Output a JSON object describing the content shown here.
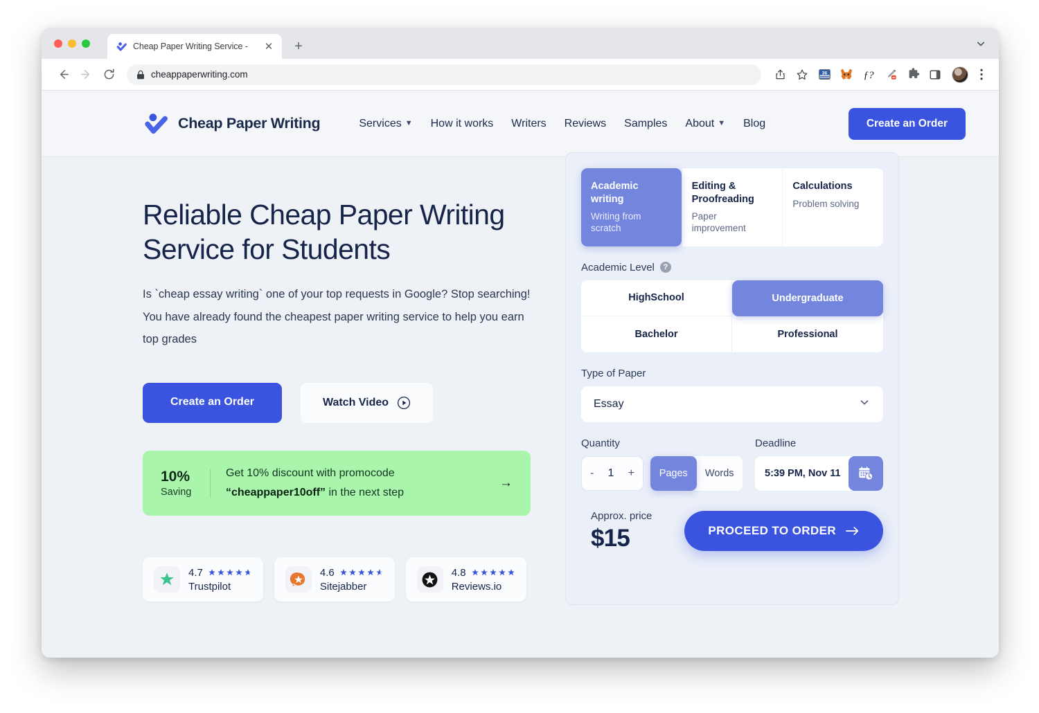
{
  "browser": {
    "tab": {
      "title": "Cheap Paper Writing Service -",
      "favicon_icon": "checkmark-logo-icon",
      "close_icon": "close-icon"
    },
    "new_tab_icon": "plus-icon",
    "tabstrip_chevron_icon": "chevron-down-icon",
    "back_icon": "arrow-left-icon",
    "forward_icon": "arrow-right-icon",
    "reload_icon": "reload-icon",
    "url": "cheappaperwriting.com",
    "lock_icon": "lock-icon",
    "toolbar_icons": [
      {
        "name": "share-icon",
        "label": ""
      },
      {
        "name": "bookmark-star-icon",
        "label": ""
      },
      {
        "name": "counter-badge-icon",
        "label": "36"
      },
      {
        "name": "metamask-fox-icon",
        "label": ""
      },
      {
        "name": "italic-f-question-icon",
        "label": "ƒ?"
      },
      {
        "name": "eyedropper-icon",
        "label": ""
      },
      {
        "name": "extensions-puzzle-icon",
        "label": ""
      },
      {
        "name": "side-panel-icon",
        "label": ""
      }
    ],
    "avatar_icon": "avatar",
    "menu_icon": "kebab-menu-icon"
  },
  "site_header": {
    "logo_icon": "checkmark-logo-icon",
    "brand": "Cheap Paper Writing",
    "nav": [
      {
        "label": "Services",
        "has_caret": true
      },
      {
        "label": "How it works",
        "has_caret": false
      },
      {
        "label": "Writers",
        "has_caret": false
      },
      {
        "label": "Reviews",
        "has_caret": false
      },
      {
        "label": "Samples",
        "has_caret": false
      },
      {
        "label": "About",
        "has_caret": true
      },
      {
        "label": "Blog",
        "has_caret": false
      }
    ],
    "cta": "Create an Order"
  },
  "hero": {
    "title": "Reliable Cheap Paper Writing Service for Students",
    "subtitle": "Is `cheap essay writing` one of your top requests in Google? Stop searching! You have already found the cheapest paper writing service to help you earn top grades",
    "primary_cta": "Create an Order",
    "watch_video": "Watch Video",
    "play_icon": "play-circle-icon"
  },
  "promo": {
    "percent": "10%",
    "saving_label": "Saving",
    "line1": "Get 10% discount with promocode",
    "code": "“cheappaper10off”",
    "line2_tail": " in the next step",
    "arrow_icon": "arrow-right-icon"
  },
  "ratings": [
    {
      "score": "4.7",
      "name": "Trustpilot",
      "icon": "trustpilot-star-icon",
      "stars": 4.7,
      "color": "#3dc28c"
    },
    {
      "score": "4.6",
      "name": "Sitejabber",
      "icon": "sitejabber-bubble-icon",
      "stars": 4.6,
      "color": "#e8762c"
    },
    {
      "score": "4.8",
      "name": "Reviews.io",
      "icon": "reviewsio-star-icon",
      "stars": 4.8,
      "color": "#111111"
    }
  ],
  "order_form": {
    "service_tabs": [
      {
        "title": "Academic writing",
        "subtitle": "Writing from scratch",
        "active": true
      },
      {
        "title": "Editing & Proofreading",
        "subtitle": "Paper improvement",
        "active": false
      },
      {
        "title": "Calculations",
        "subtitle": "Problem solving",
        "active": false
      }
    ],
    "academic_level": {
      "label": "Academic Level",
      "help_icon": "question-mark-icon",
      "help_glyph": "?",
      "options": [
        {
          "label": "HighSchool",
          "active": false
        },
        {
          "label": "Undergraduate",
          "active": true
        },
        {
          "label": "Bachelor",
          "active": false
        },
        {
          "label": "Professional",
          "active": false
        }
      ]
    },
    "paper_type": {
      "label": "Type of Paper",
      "value": "Essay",
      "chevron_icon": "chevron-down-icon"
    },
    "quantity": {
      "label": "Quantity",
      "minus": "-",
      "value": "1",
      "plus": "+",
      "units": [
        {
          "label": "Pages",
          "active": true
        },
        {
          "label": "Words",
          "active": false
        }
      ]
    },
    "deadline": {
      "label": "Deadline",
      "value": "5:39 PM, Nov 11",
      "calendar_icon": "calendar-clock-icon"
    },
    "price": {
      "label": "Approx. price",
      "value": "$15"
    },
    "proceed": {
      "label": "PROCEED TO ORDER",
      "arrow_icon": "arrow-right-icon"
    }
  },
  "colors": {
    "brand_blue": "#3b54e0",
    "accent_periwinkle": "#7385dd",
    "promo_green": "#a9f5ac",
    "page_bg": "#eef1f6",
    "panel_bg": "#eaeff8",
    "text_navy": "#16244a"
  }
}
